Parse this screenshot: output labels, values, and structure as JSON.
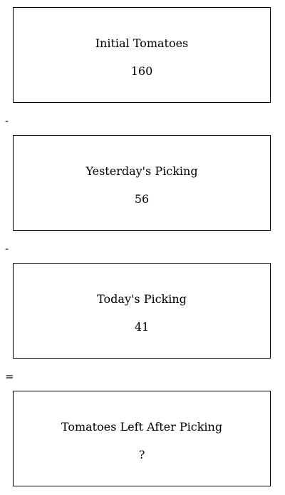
{
  "steps": [
    {
      "label": "Initial Tomatoes",
      "value": "160"
    },
    {
      "label": "Yesterday's Picking",
      "value": "56"
    },
    {
      "label": "Today's Picking",
      "value": "41"
    },
    {
      "label": "Tomatoes Left After Picking",
      "value": "?"
    }
  ],
  "operators": [
    "-",
    "-",
    "="
  ]
}
